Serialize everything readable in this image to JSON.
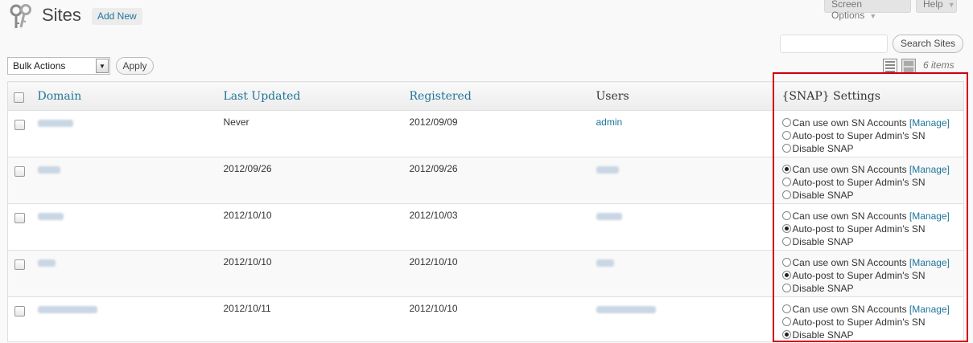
{
  "header": {
    "title": "Sites",
    "add_new": "Add New",
    "screen_options": "Screen Options",
    "help": "Help"
  },
  "search": {
    "button": "Search Sites",
    "value": ""
  },
  "bulk": {
    "selected": "Bulk Actions",
    "apply": "Apply"
  },
  "view": {
    "count": "6 items"
  },
  "table": {
    "columns": [
      "Domain",
      "Last Updated",
      "Registered",
      "Users",
      "{SNAP} Settings"
    ],
    "snap_options": [
      "Can use own SN Accounts",
      "Auto-post to Super Admin's SN",
      "Disable SNAP"
    ],
    "manage": "[Manage]",
    "rows": [
      {
        "last_updated": "Never",
        "registered": "2012/09/09",
        "user": "admin",
        "snap_selected": -1
      },
      {
        "last_updated": "2012/09/26",
        "registered": "2012/09/26",
        "user": "",
        "snap_selected": 0
      },
      {
        "last_updated": "2012/10/10",
        "registered": "2012/10/03",
        "user": "",
        "snap_selected": 1
      },
      {
        "last_updated": "2012/10/10",
        "registered": "2012/10/10",
        "user": "",
        "snap_selected": 1
      },
      {
        "last_updated": "2012/10/11",
        "registered": "2012/10/10",
        "user": "",
        "snap_selected": 2
      }
    ]
  },
  "icons": {
    "page": "keys-icon",
    "list_view": "list-view-icon",
    "excerpt_view": "excerpt-view-icon"
  },
  "colors": {
    "link": "#21759b",
    "highlight_box": "#d0000b"
  }
}
